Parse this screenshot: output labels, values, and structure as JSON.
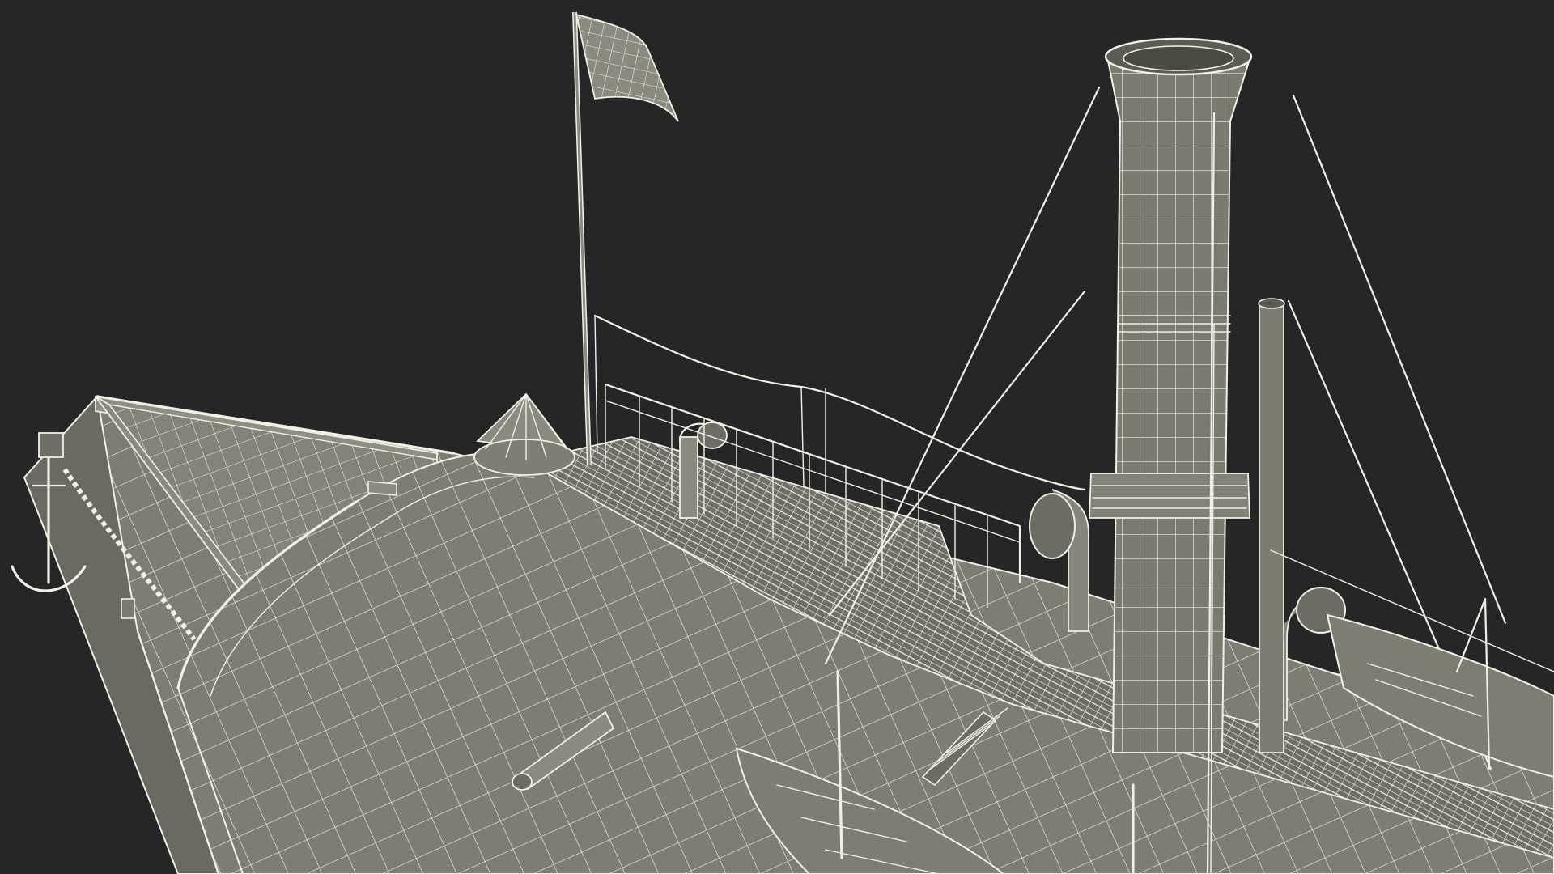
{
  "scene": {
    "subject": "steamboat-wireframe-model",
    "colors": {
      "background": "#262626",
      "surface": "#7d7d73",
      "surface_light": "#8b8b80",
      "surface_dark": "#5e5e56",
      "wire": "#f2f0e6"
    }
  }
}
